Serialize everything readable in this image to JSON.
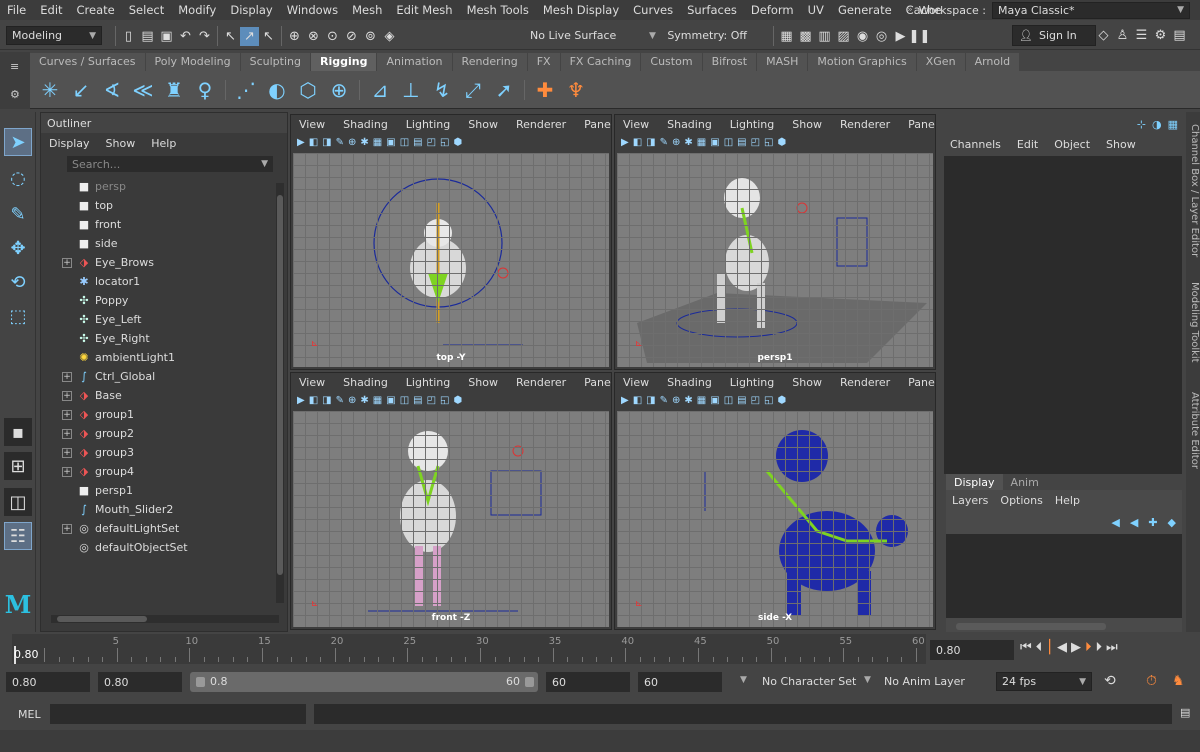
{
  "menu": [
    "File",
    "Edit",
    "Create",
    "Select",
    "Modify",
    "Display",
    "Windows",
    "Mesh",
    "Edit Mesh",
    "Mesh Tools",
    "Mesh Display",
    "Curves",
    "Surfaces",
    "Deform",
    "UV",
    "Generate",
    "Cache"
  ],
  "workspace": {
    "label": "Workspace :",
    "value": "Maya Classic*"
  },
  "status": {
    "mode": "Modeling",
    "live_surface": "No Live Surface",
    "symmetry": "Symmetry: Off",
    "sign_in": "Sign In"
  },
  "shelf_tabs": [
    "Curves / Surfaces",
    "Poly Modeling",
    "Sculpting",
    "Rigging",
    "Animation",
    "Rendering",
    "FX",
    "FX Caching",
    "Custom",
    "Bifrost",
    "MASH",
    "Motion Graphics",
    "XGen",
    "Arnold"
  ],
  "shelf_active": "Rigging",
  "outliner": {
    "title": "Outliner",
    "menu": [
      "Display",
      "Show",
      "Help"
    ],
    "search_placeholder": "Search...",
    "items": [
      {
        "label": "persp",
        "icon": "camera-icon",
        "expand": false,
        "dim": true
      },
      {
        "label": "top",
        "icon": "camera-icon",
        "expand": false
      },
      {
        "label": "front",
        "icon": "camera-icon",
        "expand": false
      },
      {
        "label": "side",
        "icon": "camera-icon",
        "expand": false
      },
      {
        "label": "Eye_Brows",
        "icon": "transform-icon",
        "expand": true
      },
      {
        "label": "locator1",
        "icon": "locator-icon",
        "expand": false
      },
      {
        "label": "Poppy",
        "icon": "joint-icon",
        "expand": false
      },
      {
        "label": "Eye_Left",
        "icon": "joint-icon",
        "expand": false
      },
      {
        "label": "Eye_Right",
        "icon": "joint-icon",
        "expand": false
      },
      {
        "label": "ambientLight1",
        "icon": "light-icon",
        "expand": false
      },
      {
        "label": "Ctrl_Global",
        "icon": "curve-icon",
        "expand": true
      },
      {
        "label": "Base",
        "icon": "transform-icon",
        "expand": true
      },
      {
        "label": "group1",
        "icon": "transform-icon",
        "expand": true
      },
      {
        "label": "group2",
        "icon": "transform-icon",
        "expand": true
      },
      {
        "label": "group3",
        "icon": "transform-icon",
        "expand": true
      },
      {
        "label": "group4",
        "icon": "transform-icon",
        "expand": true
      },
      {
        "label": "persp1",
        "icon": "camera-icon",
        "expand": false
      },
      {
        "label": "Mouth_Slider2",
        "icon": "curve-icon",
        "expand": false
      },
      {
        "label": "defaultLightSet",
        "icon": "set-icon",
        "expand": true
      },
      {
        "label": "defaultObjectSet",
        "icon": "set-icon",
        "expand": false
      }
    ]
  },
  "viewport_menu": [
    "View",
    "Shading",
    "Lighting",
    "Show",
    "Renderer",
    "Panels"
  ],
  "viewports": [
    {
      "camera": "top -Y"
    },
    {
      "camera": "persp1"
    },
    {
      "camera": "front -Z"
    },
    {
      "camera": "side -X"
    }
  ],
  "channelbox": {
    "menu": [
      "Channels",
      "Edit",
      "Object",
      "Show"
    ],
    "tabs": [
      "Display",
      "Anim"
    ],
    "layer_menu": [
      "Layers",
      "Options",
      "Help"
    ]
  },
  "side_tabs": [
    "Channel Box / Layer Editor",
    "Modeling Toolkit",
    "Attribute Editor"
  ],
  "timeline": {
    "ticks": [
      "5",
      "10",
      "15",
      "20",
      "25",
      "30",
      "35",
      "40",
      "45",
      "50",
      "55",
      "60"
    ],
    "current_frame": "0.80",
    "current_field": "0.80"
  },
  "range": {
    "start": "0.80",
    "anim_start": "0.80",
    "slider_start": "0.8",
    "slider_end": "60",
    "end": "60",
    "anim_end": "60",
    "character_set": "No Character Set",
    "anim_layer": "No Anim Layer",
    "fps": "24 fps"
  },
  "cmd": {
    "lang": "MEL"
  }
}
